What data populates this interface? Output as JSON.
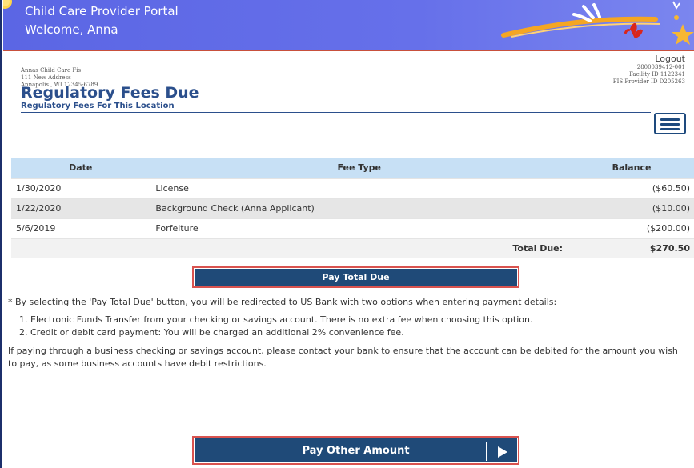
{
  "header": {
    "app_title": "Child Care Provider Portal",
    "welcome": "Welcome, Anna"
  },
  "provider": {
    "name": "Annas Child Care Fis",
    "address1": "111 New Address",
    "address2": "Annapolis , WI 12345-6789"
  },
  "account": {
    "logout_label": "Logout",
    "number": "2800039412-001",
    "facility_id": "Facility ID 1122341",
    "fis_provider_id": "FIS Provider ID D205263"
  },
  "page": {
    "title": "Regulatory Fees Due",
    "subtitle": "Regulatory Fees For This Location"
  },
  "table": {
    "headers": [
      "Date",
      "Fee Type",
      "Balance"
    ],
    "rows": [
      {
        "date": "1/30/2020",
        "fee_type": "License",
        "balance": "($60.50)"
      },
      {
        "date": "1/22/2020",
        "fee_type": "Background Check (Anna Applicant)",
        "balance": "($10.00)"
      },
      {
        "date": "5/6/2019",
        "fee_type": "Forfeiture",
        "balance": "($200.00)"
      }
    ],
    "total_label": "Total Due:",
    "total_value": "$270.50"
  },
  "actions": {
    "pay_total_label": "Pay Total Due",
    "pay_other_label": "Pay Other Amount"
  },
  "notes": {
    "intro": "* By selecting the 'Pay Total Due' button, you will be redirected to US Bank with two options when entering payment details:",
    "options": [
      "Electronic Funds Transfer from your checking or savings account. There is no extra fee when choosing this option.",
      "Credit or debit card payment: You will be charged an additional 2% convenience fee."
    ],
    "business_warning": "If paying through a business checking or savings account, please contact your bank to ensure that the account can be debited for the amount you wish to pay, as some business accounts have debit restrictions."
  },
  "colors": {
    "banner": "#5b66e4",
    "title_blue": "#2b4f8c",
    "button_navy": "#1f4a78",
    "highlight_red": "#d9534f",
    "table_header": "#c7e0f5"
  },
  "icons": [
    "sun-icon",
    "banner-artwork",
    "hamburger-menu-icon",
    "play-arrow-icon"
  ]
}
